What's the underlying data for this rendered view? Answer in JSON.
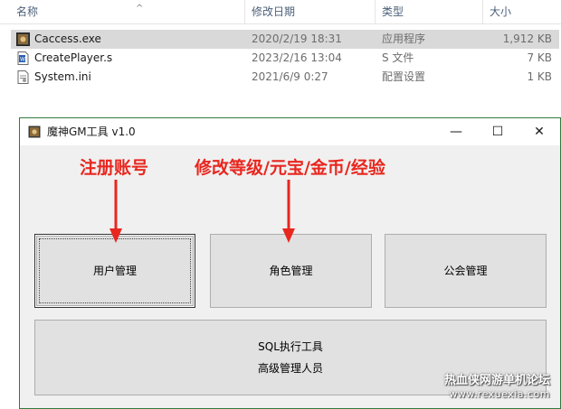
{
  "explorer": {
    "columns": {
      "name": "名称",
      "date": "修改日期",
      "type": "类型",
      "size": "大小"
    },
    "files": [
      {
        "icon": "app-exe-icon",
        "name": "Caccess.exe",
        "date": "2020/2/19 18:31",
        "type": "应用程序",
        "size": "1,912 KB",
        "selected": true
      },
      {
        "icon": "sql-file-icon",
        "name": "CreatePlayer.s",
        "date": "2023/2/16 13:04",
        "type": "S 文件",
        "size": "7 KB",
        "selected": false
      },
      {
        "icon": "ini-file-icon",
        "name": "System.ini",
        "date": "2021/6/9 0:27",
        "type": "配置设置",
        "size": "1 KB",
        "selected": false
      }
    ]
  },
  "window": {
    "title": "魔神GM工具 v1.0",
    "controls": {
      "minimize": "—",
      "maximize": "☐",
      "close": "✕"
    },
    "buttons": {
      "user_manage": "用户管理",
      "role_manage": "角色管理",
      "guild_manage": "公会管理",
      "sql_tool_line1": "SQL执行工具",
      "sql_tool_line2": "高级管理人员"
    }
  },
  "annotations": {
    "register": "注册账号",
    "modify": "修改等级/元宝/金币/经验"
  },
  "watermark": {
    "line1": "热血侠网游单机论坛",
    "line2": "www.rexuexia.com"
  },
  "colors": {
    "annotation_red": "#e8271f",
    "window_border": "#2f7a3a",
    "selection": "#d9d9d9"
  }
}
